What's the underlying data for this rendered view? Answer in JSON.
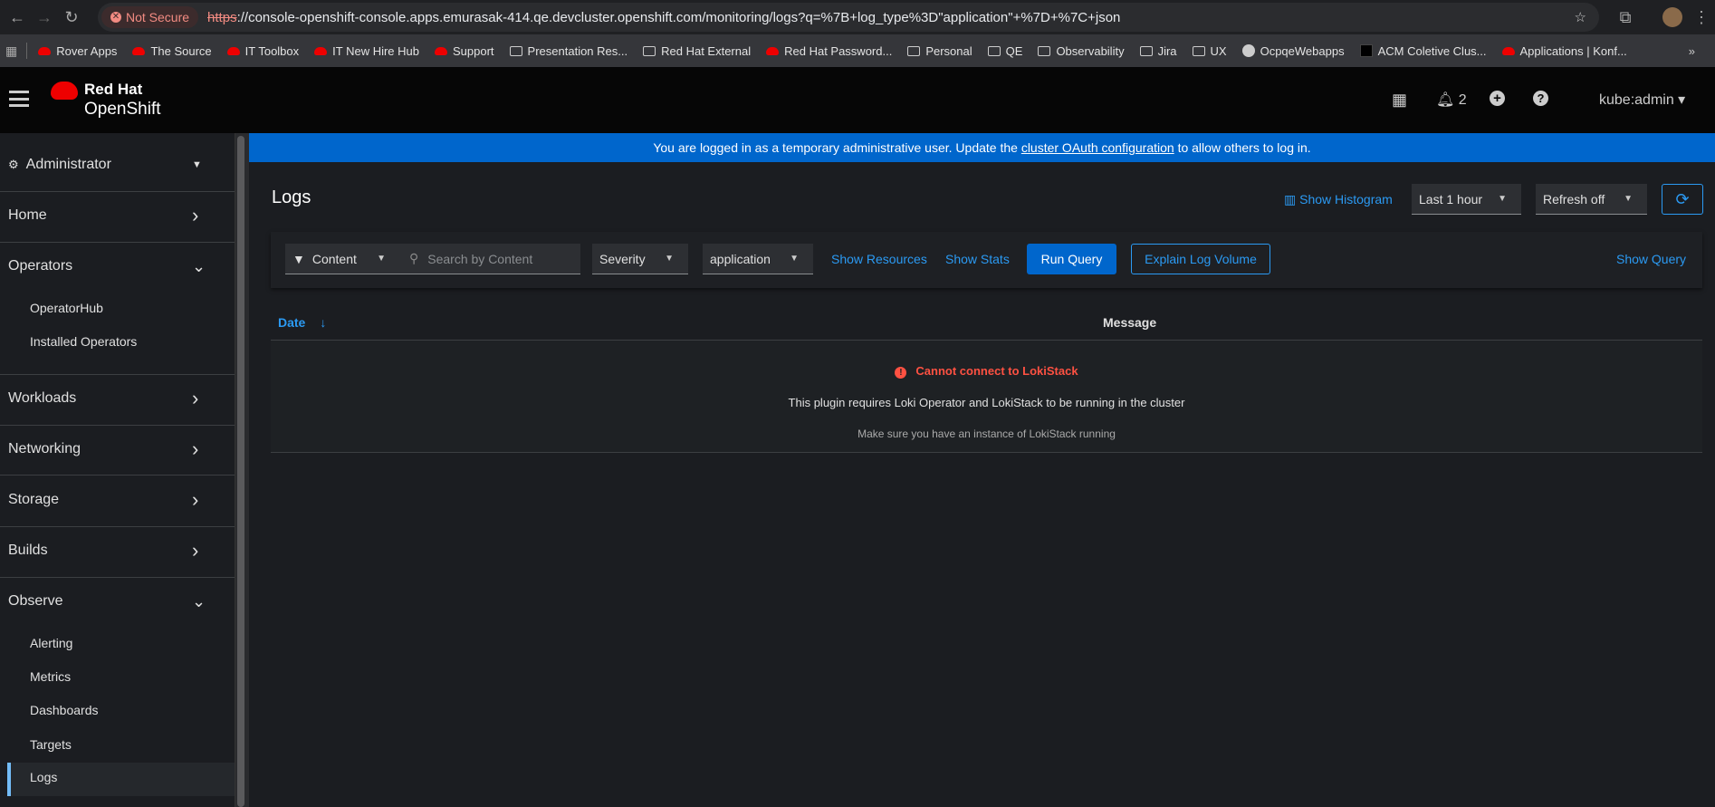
{
  "browser": {
    "security": "Not Secure",
    "url_scheme": "https",
    "url_rest": "://console-openshift-console.apps.emurasak-414.qe.devcluster.openshift.com/monitoring/logs?q=%7B+log_type%3D\"application\"+%7D+%7C+json",
    "bookmarks": [
      {
        "label": "Rover Apps",
        "icon": "redhat"
      },
      {
        "label": "The Source",
        "icon": "redhat"
      },
      {
        "label": "IT Toolbox",
        "icon": "redhat"
      },
      {
        "label": "IT New Hire Hub",
        "icon": "redhat"
      },
      {
        "label": "Support",
        "icon": "redhat"
      },
      {
        "label": "Presentation Res...",
        "icon": "folder"
      },
      {
        "label": "Red Hat External",
        "icon": "folder"
      },
      {
        "label": "Red Hat Password...",
        "icon": "redhat"
      },
      {
        "label": "Personal",
        "icon": "folder"
      },
      {
        "label": "QE",
        "icon": "folder"
      },
      {
        "label": "Observability",
        "icon": "folder"
      },
      {
        "label": "Jira",
        "icon": "folder"
      },
      {
        "label": "UX",
        "icon": "folder"
      },
      {
        "label": "OcpqeWebapps",
        "icon": "globe"
      },
      {
        "label": "ACM Coletive Clus...",
        "icon": "acm"
      },
      {
        "label": "Applications | Konf...",
        "icon": "redhat"
      }
    ],
    "more": "»"
  },
  "masthead": {
    "brand_top": "Red Hat",
    "brand_bottom": "OpenShift",
    "notifications": "2",
    "user": "kube:admin"
  },
  "banner": {
    "before": "You are logged in as a temporary administrative user. Update the ",
    "link": "cluster OAuth configuration",
    "after": " to allow others to log in."
  },
  "sidebar": {
    "perspective": "Administrator",
    "sections": [
      "Home",
      "Operators",
      "Workloads",
      "Networking",
      "Storage",
      "Builds",
      "Observe"
    ],
    "operators_items": [
      "OperatorHub",
      "Installed Operators"
    ],
    "observe_items": [
      "Alerting",
      "Metrics",
      "Dashboards",
      "Targets",
      "Logs"
    ]
  },
  "page": {
    "title": "Logs",
    "show_histogram": "Show Histogram",
    "time_range": "Last 1 hour",
    "refresh": "Refresh off",
    "filter_attribute": "Content",
    "search_placeholder": "Search by Content",
    "severity": "Severity",
    "tenant": "application",
    "show_resources": "Show Resources",
    "show_stats": "Show Stats",
    "run_query": "Run Query",
    "explain": "Explain Log Volume",
    "show_query": "Show Query",
    "col_date": "Date",
    "col_message": "Message",
    "error_title": "Cannot connect to LokiStack",
    "error_body": "This plugin requires Loki Operator and LokiStack to be running in the cluster",
    "error_hint": "Make sure you have an instance of LokiStack running"
  },
  "colors": {
    "accent": "#2b9af3",
    "primary": "#0066cc",
    "danger": "#fe5142"
  }
}
